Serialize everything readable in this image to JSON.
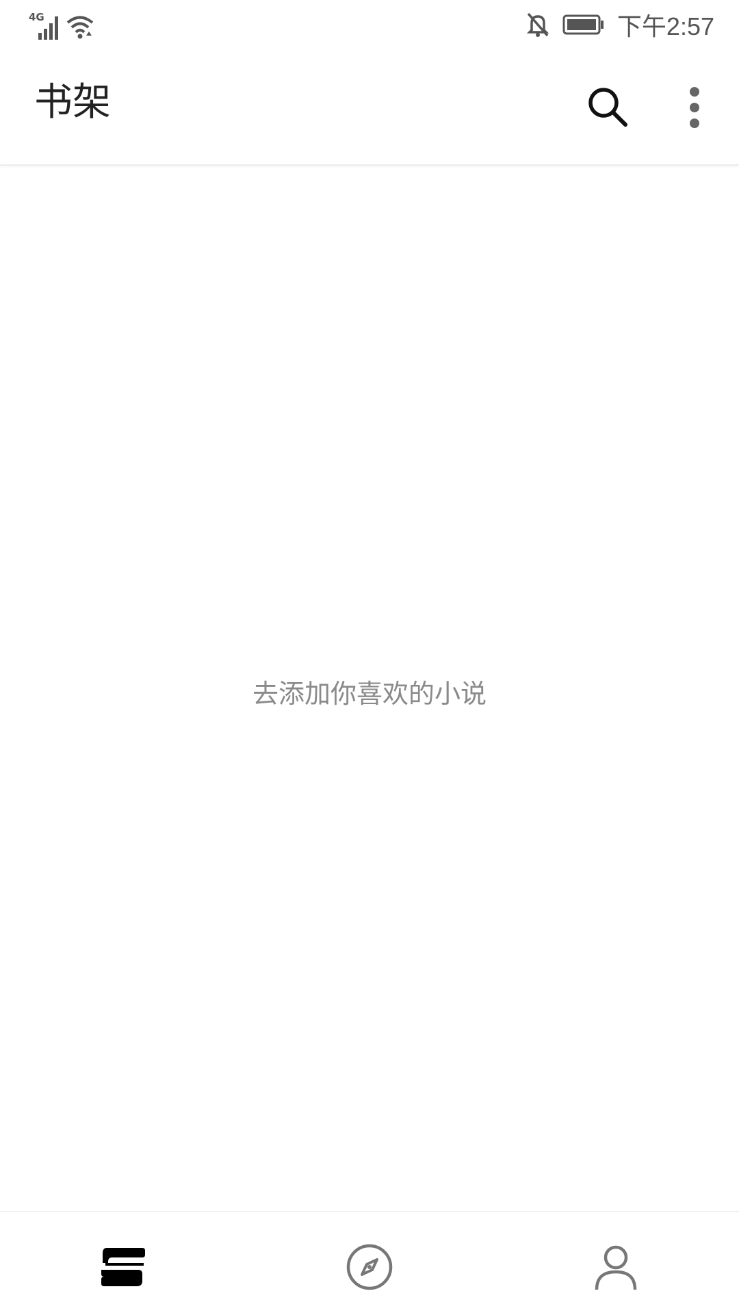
{
  "status_bar": {
    "network_type": "4G",
    "time": "下午2:57",
    "icons": [
      "signal-icon",
      "wifi-icon",
      "bell-off-icon",
      "battery-icon"
    ]
  },
  "app_bar": {
    "title": "书架",
    "actions": [
      "search-icon",
      "more-vert-icon"
    ]
  },
  "empty_state": {
    "message": "去添加你喜欢的小说"
  },
  "bottom_nav": {
    "items": [
      {
        "icon": "bookshelf-icon",
        "active": true
      },
      {
        "icon": "compass-icon",
        "active": false
      },
      {
        "icon": "profile-icon",
        "active": false
      }
    ]
  },
  "colors": {
    "title": "#222222",
    "muted_text": "#8a8a8a",
    "icon_active": "#000000",
    "icon_inactive": "#777777",
    "background": "#ffffff"
  }
}
